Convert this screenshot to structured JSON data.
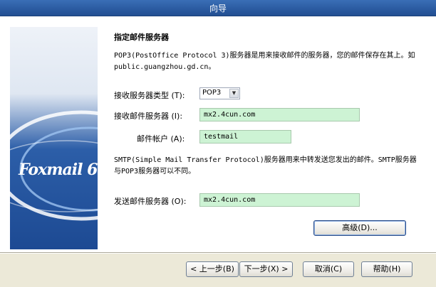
{
  "window": {
    "title": "向导"
  },
  "banner": {
    "logo_text": "Foxmail 6"
  },
  "section": {
    "heading": "指定邮件服务器",
    "pop3_description": "POP3(PostOffice Protocol 3)服务器是用来接收邮件的服务器，您的邮件保存在其上。如public.guangzhou.gd.cn。",
    "smtp_description": "SMTP(Simple Mail Transfer Protocol)服务器用来中转发送您发出的邮件。SMTP服务器与POP3服务器可以不同。"
  },
  "form": {
    "server_type_label": "接收服务器类型 (T):",
    "server_type_value": "POP3",
    "incoming_server_label": "接收邮件服务器 (I):",
    "incoming_server_value": "mx2.4cun.com",
    "account_label": "邮件帐户 (A):",
    "account_value": "testmail",
    "outgoing_server_label": "发送邮件服务器 (O):",
    "outgoing_server_value": "mx2.4cun.com"
  },
  "buttons": {
    "advanced": "高级(D)...",
    "back": "< 上一步(B)",
    "next": "下一步(X) >",
    "cancel": "取消(C)",
    "help": "帮助(H)"
  }
}
